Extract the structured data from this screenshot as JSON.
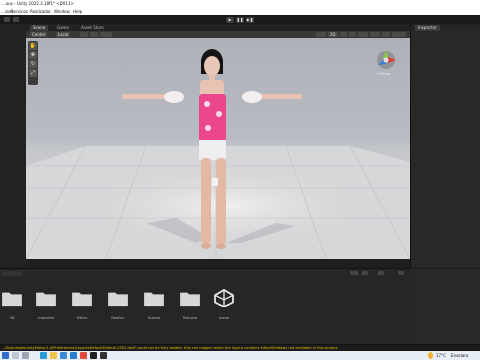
{
  "window": {
    "title": "...ous - Unity 2022.3.18f1* <DX11>"
  },
  "menu": {
    "items": [
      "...sset",
      "Servicos",
      "Realizador",
      "Window",
      "Help"
    ]
  },
  "scene_view": {
    "tabs": [
      "Scene",
      "Game",
      "Asset Store"
    ],
    "active_tab": "Scene",
    "toolbar": {
      "shading": "Center",
      "mode": "Local",
      "view2d": "2D",
      "gizmo_persp": "< Persp"
    }
  },
  "inspector": {
    "tab": "Inspector"
  },
  "project": {
    "folders": [
      {
        "label": "3D"
      },
      {
        "label": "character"
      },
      {
        "label": "Editor"
      },
      {
        "label": "Fashion"
      },
      {
        "label": "Scenes"
      },
      {
        "label": "Textures"
      },
      {
        "label": "scene"
      }
    ]
  },
  "console": {
    "message": "...DownloadsUnityEditor-5.4/Preferences/LayoutsDefaultDefault-2022.dwlf' could not be fully loaded, this can happen when the layout contains EditorWindows not available in this project."
  },
  "taskbar": {
    "weather": "17°C",
    "weather_desc": "Ensolara"
  },
  "colors": {
    "accent": "#3a72b0",
    "folder": "#d8d8d8",
    "console_warning": "#e6c200",
    "dress_pink": "#e9468c"
  }
}
